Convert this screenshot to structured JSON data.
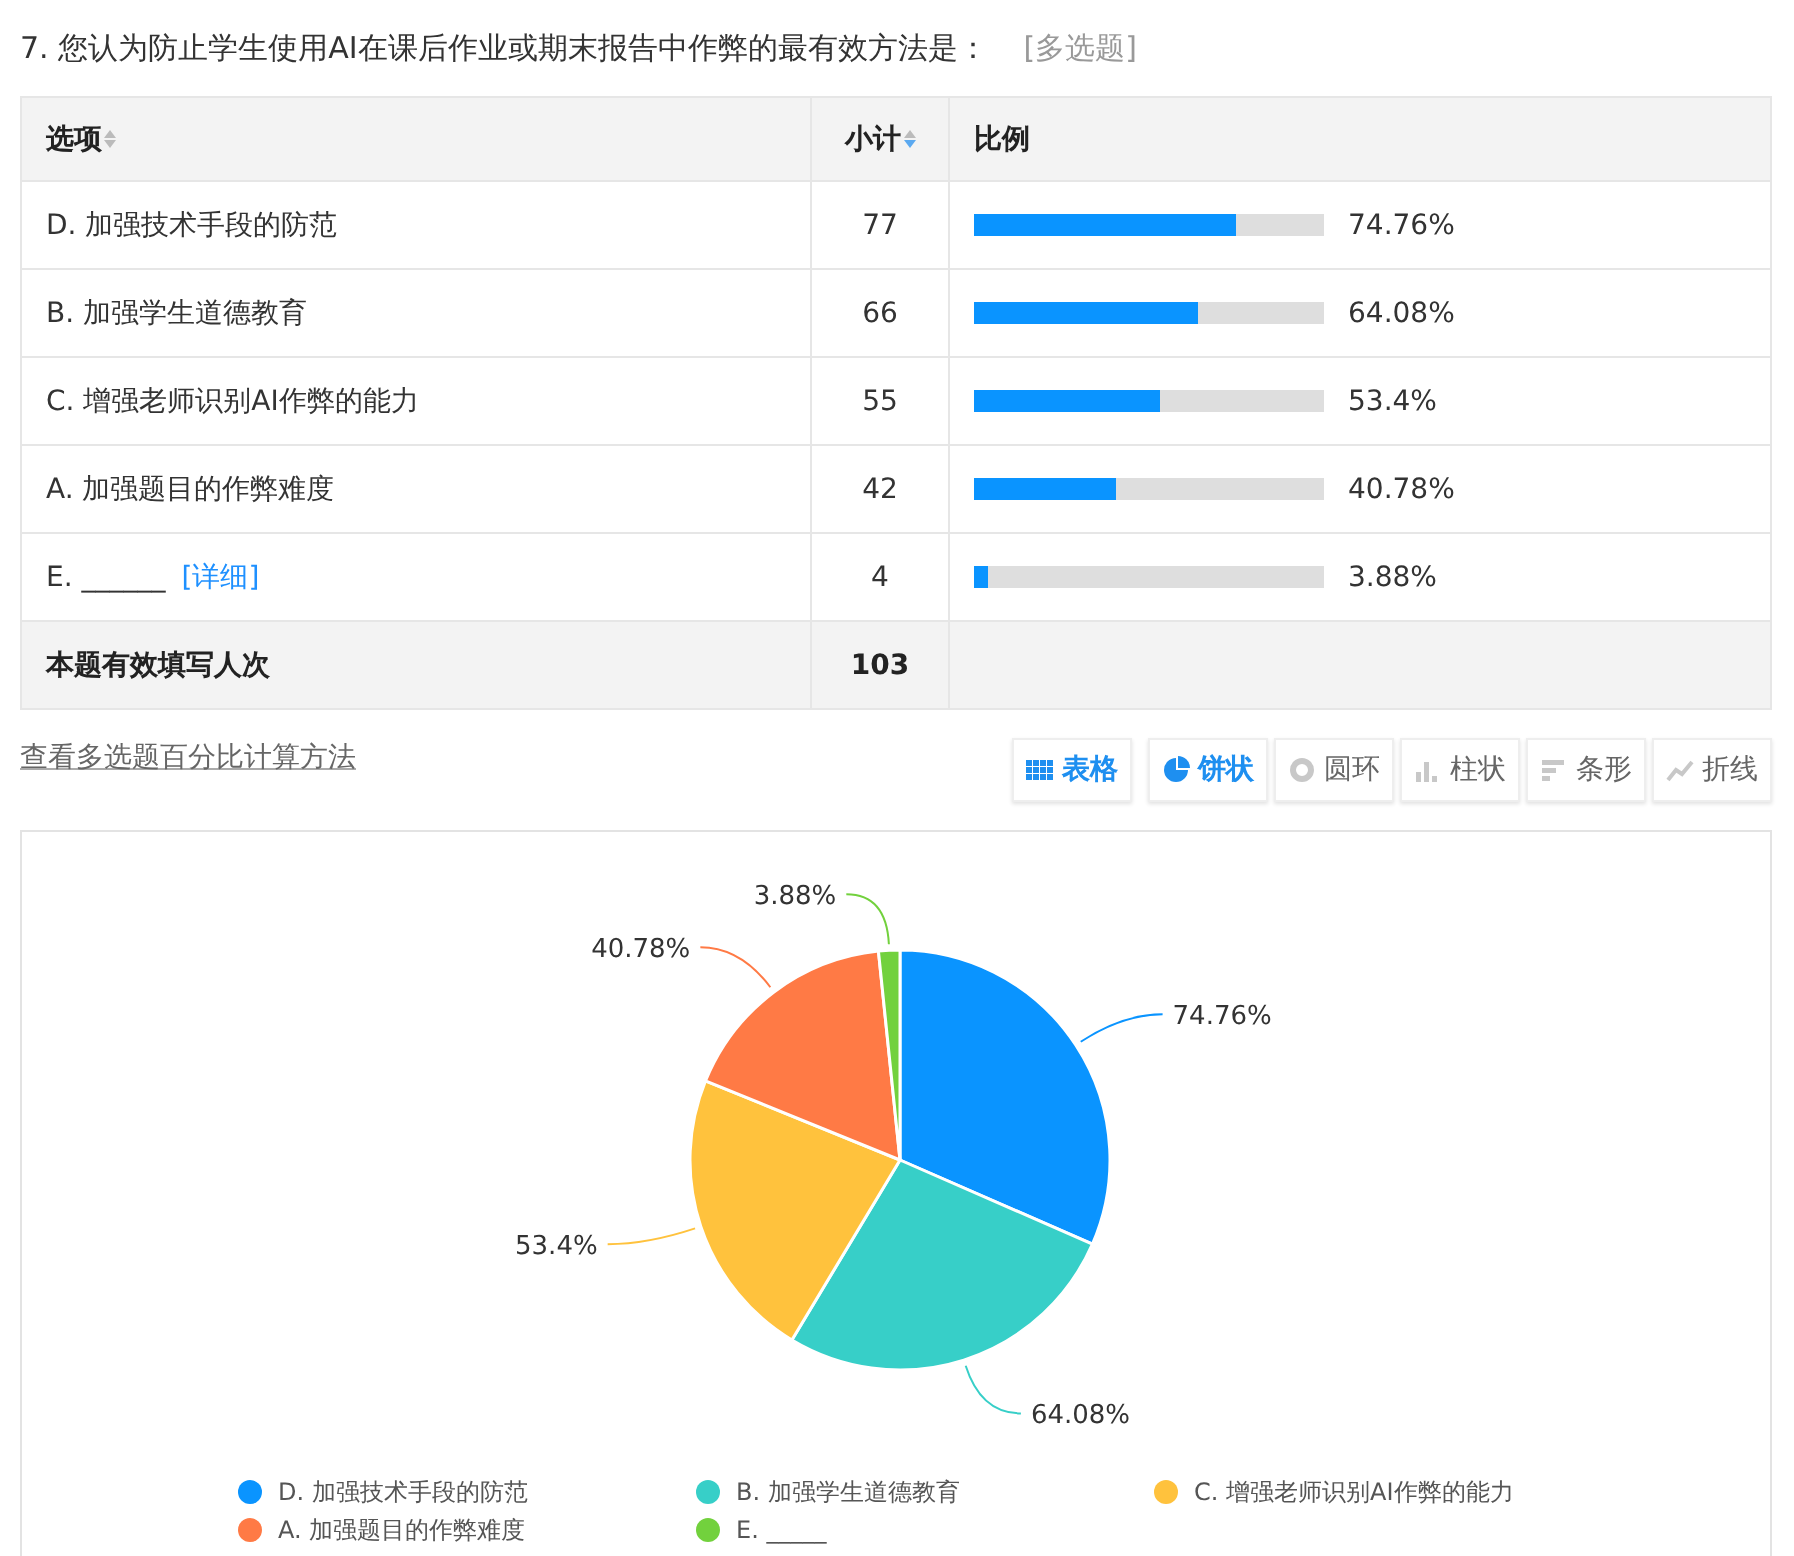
{
  "question": {
    "title": "7. 您认为防止学生使用AI在课后作业或期末报告中作弊的最有效方法是：",
    "tag": "[多选题]"
  },
  "table": {
    "columns": [
      {
        "label": "选项",
        "sortable": true
      },
      {
        "label": "小计",
        "sortable": true
      },
      {
        "label": "比例",
        "sortable": false
      }
    ],
    "rows": [
      {
        "label": "D. 加强技术手段的防范",
        "count": "77",
        "level": 0.7476,
        "percent": "74.76%"
      },
      {
        "label": "B. 加强学生道德教育",
        "count": "66",
        "level": 0.6408,
        "percent": "64.08%"
      },
      {
        "label": "C. 增强老师识别AI作弊的能力",
        "count": "55",
        "level": 0.534,
        "percent": "53.4%"
      },
      {
        "label": "A. 加强题目的作弊难度",
        "count": "42",
        "level": 0.4078,
        "percent": "40.78%"
      },
      {
        "label": "E. ______",
        "detail_link": "[详细]",
        "count": "4",
        "level": 0.0388,
        "percent": "3.88%"
      }
    ],
    "total": {
      "label": "本题有效填写人次",
      "count": "103"
    }
  },
  "method_link": "查看多选题百分比计算方法",
  "toolbar": [
    {
      "kind": "table",
      "label": "表格",
      "selected": true
    },
    {
      "kind": "pie",
      "label": "饼状",
      "selected": true
    },
    {
      "kind": "ring",
      "label": "圆环",
      "selected": false
    },
    {
      "kind": "column",
      "label": "柱状",
      "selected": false
    },
    {
      "kind": "bar",
      "label": "条形",
      "selected": false
    },
    {
      "kind": "line",
      "label": "折线",
      "selected": false
    }
  ],
  "chart": {
    "chart_data": {
      "type": "pie",
      "categories": [
        "D. 加强技术手段的防范",
        "B. 加强学生道德教育",
        "C. 增强老师识别AI作弊的能力",
        "A. 加强题目的作弊难度",
        "E. _____"
      ],
      "values": [
        74.76,
        64.08,
        53.4,
        40.78,
        3.88
      ],
      "value_labels": [
        "74.76%",
        "64.08%",
        "53.4%",
        "40.78%",
        "3.88%"
      ]
    },
    "legend": [
      {
        "color": "#0a94ff"
      },
      {
        "color": "#37cfc8"
      },
      {
        "color": "#ffc23d"
      },
      {
        "color": "#ff7a45"
      },
      {
        "color": "#72d13d"
      }
    ]
  }
}
